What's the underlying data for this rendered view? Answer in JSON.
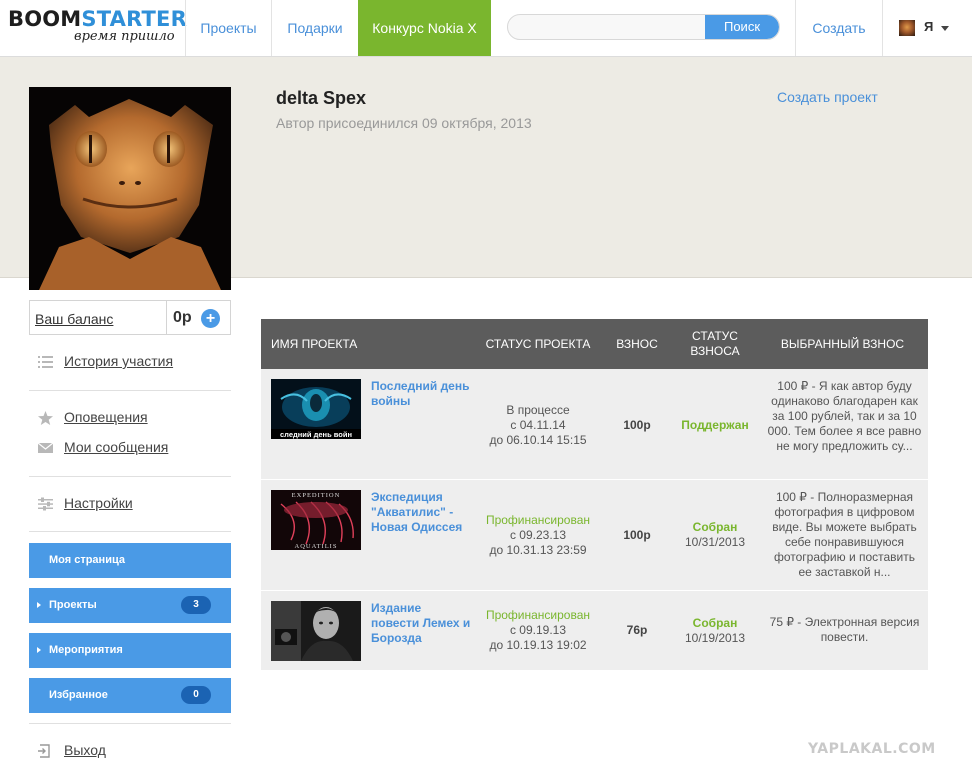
{
  "header": {
    "logo_left": "BOOM",
    "logo_right": "STARTER",
    "logo_tagline": "время пришло",
    "nav": {
      "projects": "Проекты",
      "gifts": "Подарки",
      "contest": "Конкурс Nokia X"
    },
    "search": {
      "placeholder": "",
      "button": "Поиск"
    },
    "create": "Создать",
    "user_label": "Я"
  },
  "colors": {
    "accent": "#4a90d9",
    "button_blue": "#4a9ae6",
    "contest_green": "#7ab62e",
    "status_green": "#7ab62e",
    "table_header": "#5c5c5c"
  },
  "profile": {
    "name": "delta Spex",
    "joined": "Автор присоединился 09 октября, 2013",
    "create_project": "Создать проект"
  },
  "sidebar": {
    "balance_label": "Ваш баланс",
    "balance_value": "0р",
    "links": {
      "history": "История участия",
      "notifications": "Оповещения",
      "messages": "Мои сообщения",
      "settings": "Настройки",
      "logout": "Выход"
    },
    "buttons": {
      "my_page": "Моя страница",
      "projects": "Проекты",
      "projects_count": "3",
      "events": "Мероприятия",
      "favorites": "Избранное",
      "favorites_count": "0"
    }
  },
  "table": {
    "headers": {
      "name": "ИМЯ ПРОЕКТА",
      "status": "СТАТУС ПРОЕКТА",
      "fee": "ВЗНОС",
      "fee_status_1": "СТАТУС",
      "fee_status_2": "ВЗНОСА",
      "chosen": "ВЫБРАННЫЙ ВЗНОС"
    },
    "rows": [
      {
        "name": "Последний день войны",
        "thumb_caption": "следний день войн",
        "status": "В процессе",
        "from": "с 04.11.14",
        "to": "до 06.10.14 15:15",
        "fee": "100р",
        "fee_status": "Поддержан",
        "fee_date": "",
        "chosen": "100 ₽ - Я как автор буду одинаково благодарен как за 100 рублей, так и за 10 000. Тем более я все равно не могу предложить су..."
      },
      {
        "name": "Экспедиция \"Акватилис\" - Новая Одиссея",
        "thumb_caption_top": "EXPEDITION",
        "thumb_caption_bottom": "AQUATILIS",
        "status": "Профинансирован",
        "from": "с 09.23.13",
        "to": "до 10.31.13 23:59",
        "fee": "100р",
        "fee_status": "Собран",
        "fee_date": "10/31/2013",
        "chosen": "100 ₽ - Полноразмерная фотография в цифровом виде. Вы можете выбрать себе понравившуюся фотографию и поставить ее заставкой н..."
      },
      {
        "name": "Издание повести Лемех и Борозда",
        "status": "Профинансирован",
        "from": "с 09.19.13",
        "to": "до 10.19.13 19:02",
        "fee": "76р",
        "fee_status": "Собран",
        "fee_date": "10/19/2013",
        "chosen": "75 ₽ - Электронная версия повести."
      }
    ]
  },
  "watermark": "YAPLAKAL.COM"
}
